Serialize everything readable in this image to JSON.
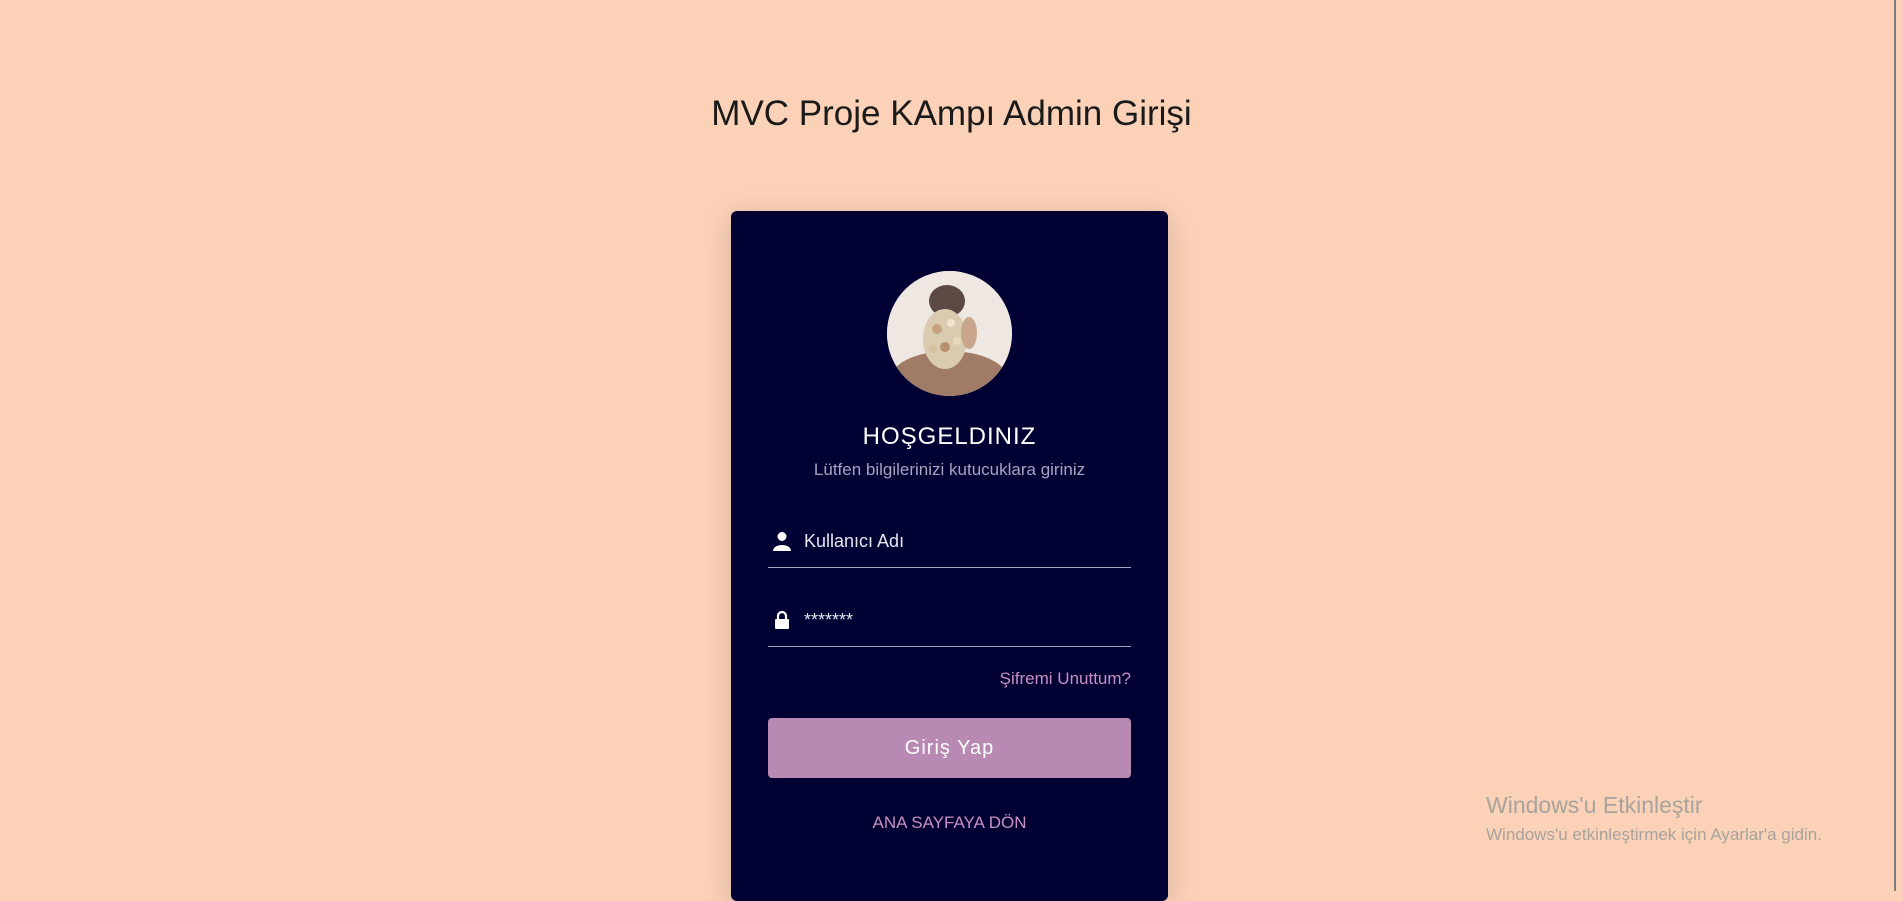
{
  "page": {
    "title": "MVC Proje KAmpı Admin Girişi",
    "background_color": "#fbd1b7"
  },
  "login_card": {
    "background_color": "#000033",
    "avatar_icon": "profile-photo",
    "welcome": "HOŞGELDINIZ",
    "subtitle": "Lütfen bilgilerinizi kutucuklara giriniz",
    "username": {
      "icon": "user-icon",
      "placeholder": "Kullanıcı Adı",
      "value": ""
    },
    "password": {
      "icon": "lock-icon",
      "placeholder": "*******",
      "value": ""
    },
    "forgot_link": "Şifremi Unuttum?",
    "login_button": "Giriş Yap",
    "home_link": "ANA SAYFAYA DÖN",
    "accent_color": "#b88ab3"
  },
  "windows_watermark": {
    "line1": "Windows'u Etkinleştir",
    "line2": "Windows'u etkinleştirmek için Ayarlar'a gidin."
  }
}
